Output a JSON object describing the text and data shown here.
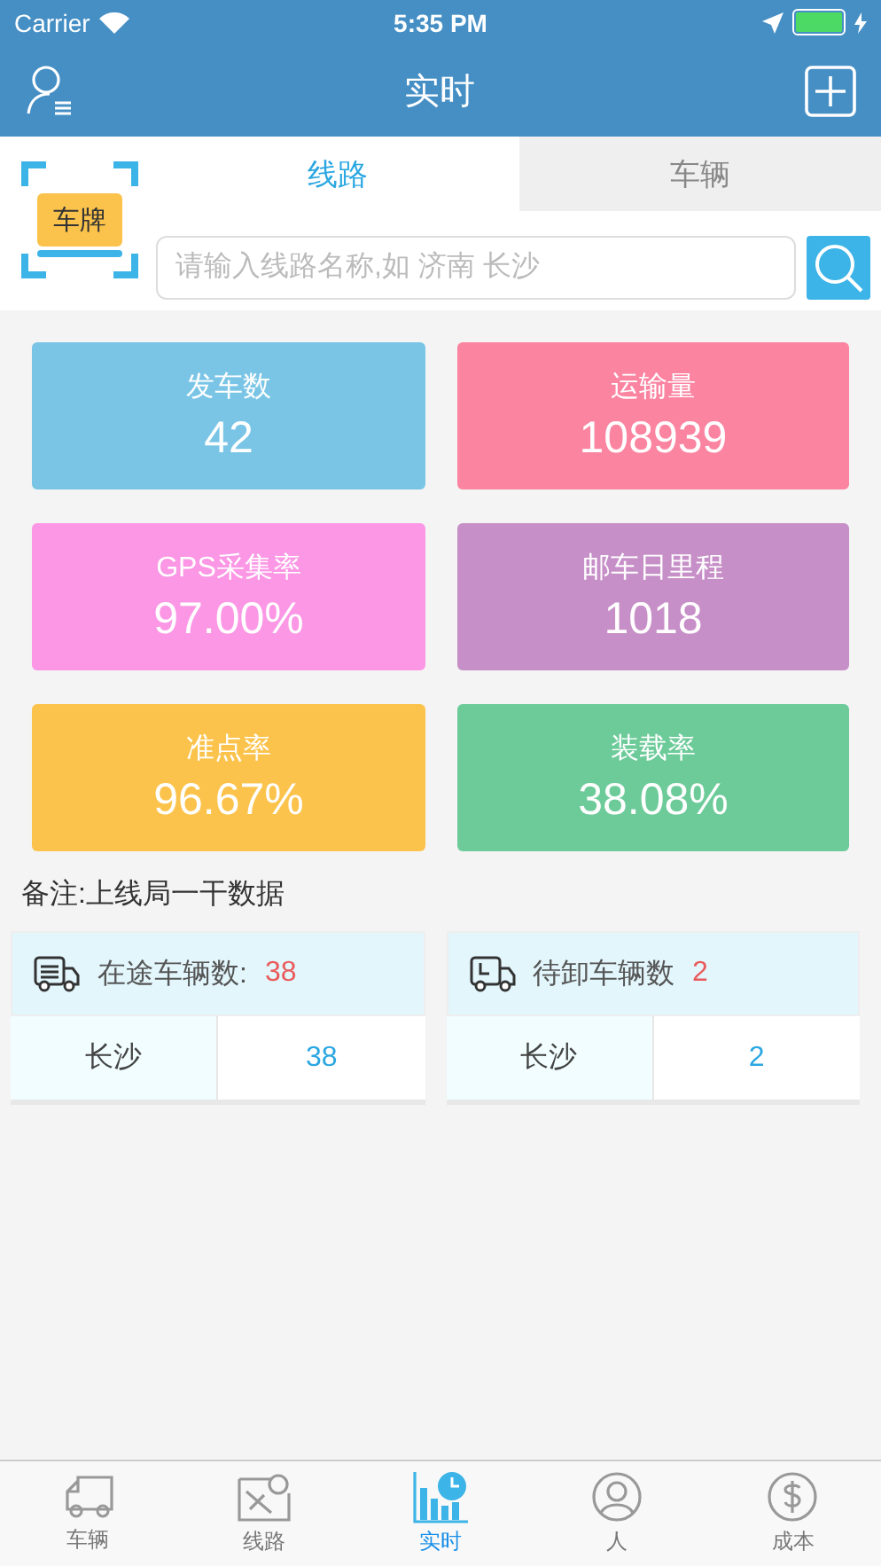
{
  "status_bar": {
    "carrier": "Carrier",
    "time": "5:35 PM"
  },
  "nav": {
    "title": "实时"
  },
  "scan_badge": {
    "label": "车牌"
  },
  "tabs": [
    {
      "label": "线路",
      "selected": true
    },
    {
      "label": "车辆",
      "selected": false
    }
  ],
  "search": {
    "placeholder": "请输入线路名称,如 济南 长沙"
  },
  "stats": [
    {
      "label": "发车数",
      "value": "42",
      "color": "#7ac5e6"
    },
    {
      "label": "运输量",
      "value": "108939",
      "color": "#fb84a1"
    },
    {
      "label": "GPS采集率",
      "value": "97.00%",
      "color": "#fb97e5"
    },
    {
      "label": "邮车日里程",
      "value": "1018",
      "color": "#c78fc8"
    },
    {
      "label": "准点率",
      "value": "96.67%",
      "color": "#fbc34c"
    },
    {
      "label": "装载率",
      "value": "38.08%",
      "color": "#6dcb9a"
    }
  ],
  "note": "备注:上线局一干数据",
  "panels": [
    {
      "title": "在途车辆数:",
      "count": "38",
      "rows": [
        {
          "city": "长沙",
          "value": "38"
        }
      ]
    },
    {
      "title": "待卸车辆数",
      "count": "2",
      "rows": [
        {
          "city": "长沙",
          "value": "2"
        }
      ]
    }
  ],
  "tab_bar": [
    {
      "label": "车辆",
      "selected": false
    },
    {
      "label": "线路",
      "selected": false
    },
    {
      "label": "实时",
      "selected": true
    },
    {
      "label": "人",
      "selected": false
    },
    {
      "label": "成本",
      "selected": false
    }
  ]
}
